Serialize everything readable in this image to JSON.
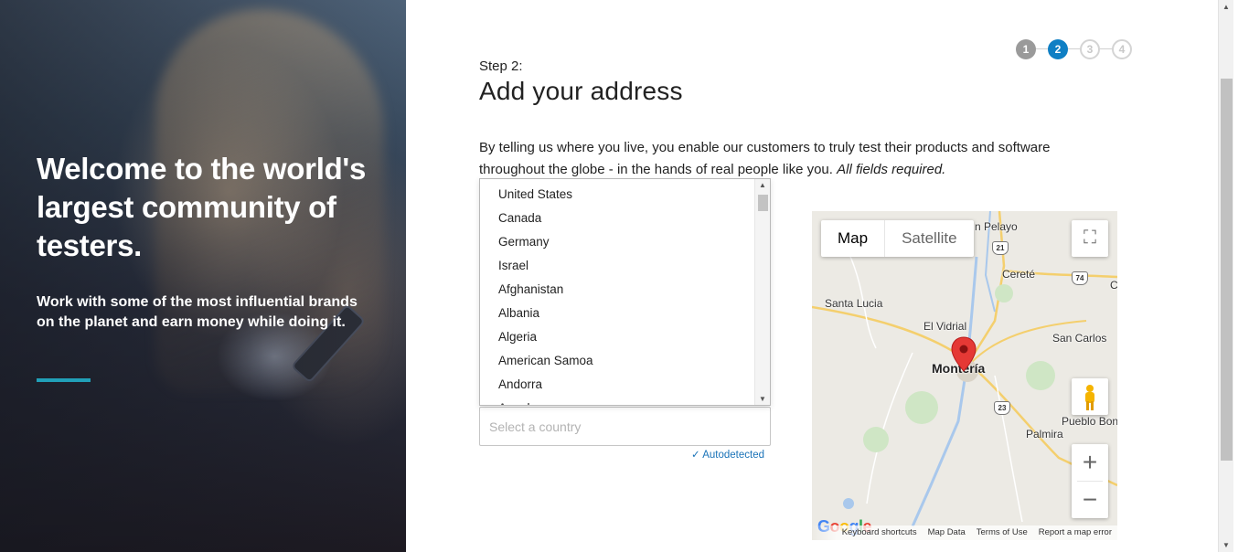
{
  "hero": {
    "title": "Welcome to the world's largest community of testers.",
    "subtitle": "Work with some of the most influential brands on the planet and earn money while doing it.",
    "accent_color": "#21a0b8"
  },
  "stepper": {
    "steps": [
      "1",
      "2",
      "3",
      "4"
    ],
    "current": 2,
    "active_color": "#0f7fc4"
  },
  "form": {
    "step_label": "Step 2:",
    "title": "Add your address",
    "intro": "By telling us where you live, you enable our customers to truly test their products and software throughout the globe - in the hands of real people like you.",
    "intro_emphasis": "All fields required.",
    "country": {
      "placeholder": "Select a country",
      "value": "",
      "autodetected_label": "Autodetected",
      "options": [
        "United States",
        "Canada",
        "Germany",
        "Israel",
        "Afghanistan",
        "Albania",
        "Algeria",
        "American Samoa",
        "Andorra",
        "Angola"
      ]
    }
  },
  "map": {
    "type_buttons": [
      "Map",
      "Satellite"
    ],
    "selected_type": "Map",
    "places": {
      "pelayo": "n Pelayo",
      "cerete": "Cereté",
      "santa_lucia": "Santa Lucia",
      "el_vidrial": "El Vidrial",
      "monteria": "Montería",
      "san_carlos": "San Carlos",
      "pueblo_bon": "Pueblo Bon",
      "palmira": "Palmira",
      "c_edge": "C"
    },
    "route_shields": [
      "21",
      "74",
      "23"
    ],
    "footer_links": [
      "Keyboard shortcuts",
      "Map Data",
      "Terms of Use",
      "Report a map error"
    ],
    "logo_text": "Google",
    "pin_color": "#e53935"
  }
}
